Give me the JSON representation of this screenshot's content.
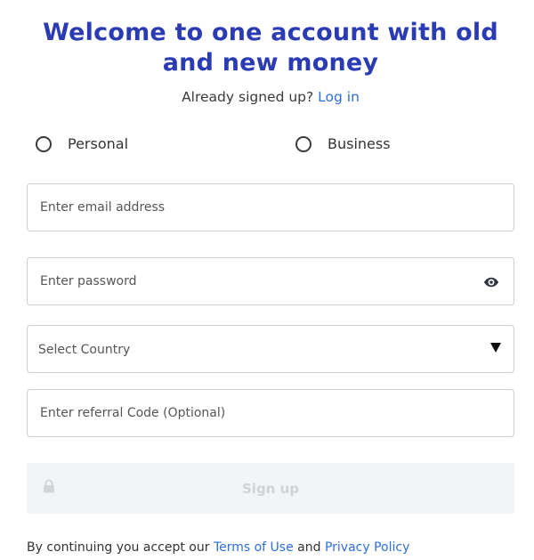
{
  "header": {
    "title_line1": "Welcome to one account with old",
    "title_line2": "and new money",
    "subtitle": "Already signed up?",
    "login_link": "Log in"
  },
  "account_type": {
    "options": [
      {
        "label": "Personal",
        "selected": false
      },
      {
        "label": "Business",
        "selected": false
      }
    ]
  },
  "form": {
    "email_placeholder": "Enter email address",
    "password_placeholder": "Enter password",
    "password_toggle_icon": "eye-icon",
    "country_placeholder": "Select Country",
    "country_dropdown_icon": "caret-down-icon",
    "referral_placeholder": "Enter referral Code (Optional)",
    "submit_label": "Sign up",
    "submit_icon": "lock-icon",
    "submit_disabled": true
  },
  "footer": {
    "prefix": "By continuing you accept our",
    "terms_link": "Terms of Use",
    "and_text": "and",
    "privacy_link": "Privacy Policy"
  },
  "colors": {
    "brand": "#2b3bb4",
    "link": "#2f6fd8",
    "button_disabled_bg": "#f3f4f6",
    "button_disabled_text": "#d0d2d6"
  }
}
